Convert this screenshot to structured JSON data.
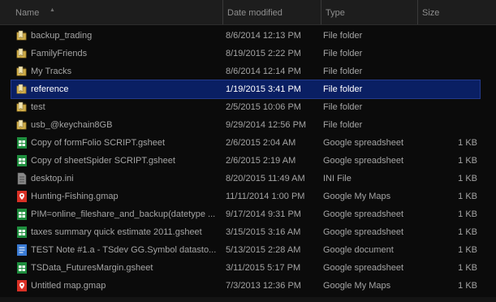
{
  "columns": {
    "name": "Name",
    "date": "Date modified",
    "type": "Type",
    "size": "Size"
  },
  "files": [
    {
      "name": "backup_trading",
      "date": "8/6/2014 12:13 PM",
      "type": "File folder",
      "size": "",
      "icon": "folder"
    },
    {
      "name": "FamilyFriends",
      "date": "8/19/2015 2:22 PM",
      "type": "File folder",
      "size": "",
      "icon": "folder"
    },
    {
      "name": "My Tracks",
      "date": "8/6/2014 12:14 PM",
      "type": "File folder",
      "size": "",
      "icon": "folder"
    },
    {
      "name": "reference",
      "date": "1/19/2015 3:41 PM",
      "type": "File folder",
      "size": "",
      "icon": "folder",
      "selected": true
    },
    {
      "name": "test",
      "date": "2/5/2015 10:06 PM",
      "type": "File folder",
      "size": "",
      "icon": "folder"
    },
    {
      "name": "usb_@keychain8GB",
      "date": "9/29/2014 12:56 PM",
      "type": "File folder",
      "size": "",
      "icon": "folder"
    },
    {
      "name": "Copy of formFolio SCRIPT.gsheet",
      "date": "2/6/2015 2:04 AM",
      "type": "Google spreadsheet",
      "size": "1 KB",
      "icon": "gsheet"
    },
    {
      "name": "Copy of sheetSpider SCRIPT.gsheet",
      "date": "2/6/2015 2:19 AM",
      "type": "Google spreadsheet",
      "size": "1 KB",
      "icon": "gsheet"
    },
    {
      "name": "desktop.ini",
      "date": "8/20/2015 11:49 AM",
      "type": "INI File",
      "size": "1 KB",
      "icon": "ini"
    },
    {
      "name": "Hunting-Fishing.gmap",
      "date": "11/11/2014 1:00 PM",
      "type": "Google My Maps",
      "size": "1 KB",
      "icon": "gmap"
    },
    {
      "name": "PIM=online_fileshare_and_backup(datetype ...",
      "date": "9/17/2014 9:31 PM",
      "type": "Google spreadsheet",
      "size": "1 KB",
      "icon": "gsheet"
    },
    {
      "name": "taxes summary quick estimate 2011.gsheet",
      "date": "3/15/2015 3:16 AM",
      "type": "Google spreadsheet",
      "size": "1 KB",
      "icon": "gsheet"
    },
    {
      "name": "TEST Note #1.a  - TSdev GG.Symbol datasto...",
      "date": "5/13/2015 2:28 AM",
      "type": "Google document",
      "size": "1 KB",
      "icon": "gdoc"
    },
    {
      "name": "TSData_FuturesMargin.gsheet",
      "date": "3/11/2015 5:17 PM",
      "type": "Google spreadsheet",
      "size": "1 KB",
      "icon": "gsheet"
    },
    {
      "name": "Untitled map.gmap",
      "date": "7/3/2013 12:36 PM",
      "type": "Google My Maps",
      "size": "1 KB",
      "icon": "gmap"
    }
  ]
}
